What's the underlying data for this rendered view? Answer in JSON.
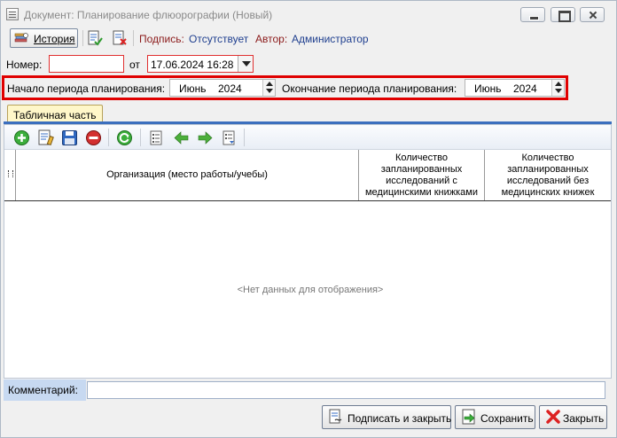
{
  "window": {
    "title": "Документ: Планирование флюорографии (Новый)"
  },
  "toolbar": {
    "history_label": "История",
    "signature_label": "Подпись:",
    "signature_value": "Отсутствует",
    "author_label": "Автор:",
    "author_value": "Администратор"
  },
  "form": {
    "number_label": "Номер:",
    "number_value": "",
    "date_label": "от",
    "date_value": "17.06.2024 16:28",
    "period_start_label": "Начало периода планирования:",
    "period_start_month": "Июнь",
    "period_start_year": "2024",
    "period_end_label": "Окончание периода планирования:",
    "period_end_month": "Июнь",
    "period_end_year": "2024"
  },
  "tabs": [
    {
      "label": "Табличная часть",
      "active": true
    }
  ],
  "grid": {
    "columns": [
      "Организация (место работы/учебы)",
      "Количество запланированных исследований с медицинскими книжками",
      "Количество запланированных исследований без медицинских книжек"
    ],
    "rows": [],
    "empty_text": "<Нет данных для отображения>"
  },
  "comment": {
    "label": "Комментарий:",
    "value": ""
  },
  "footer": {
    "sign_close_label": "Подписать и закрыть",
    "save_label": "Сохранить",
    "close_label": "Закрыть"
  },
  "colors": {
    "accent_red": "#e00000",
    "label_red": "#8b1a1a",
    "value_blue": "#1f3f8f",
    "tab_strip_blue": "#3b6fbe"
  }
}
